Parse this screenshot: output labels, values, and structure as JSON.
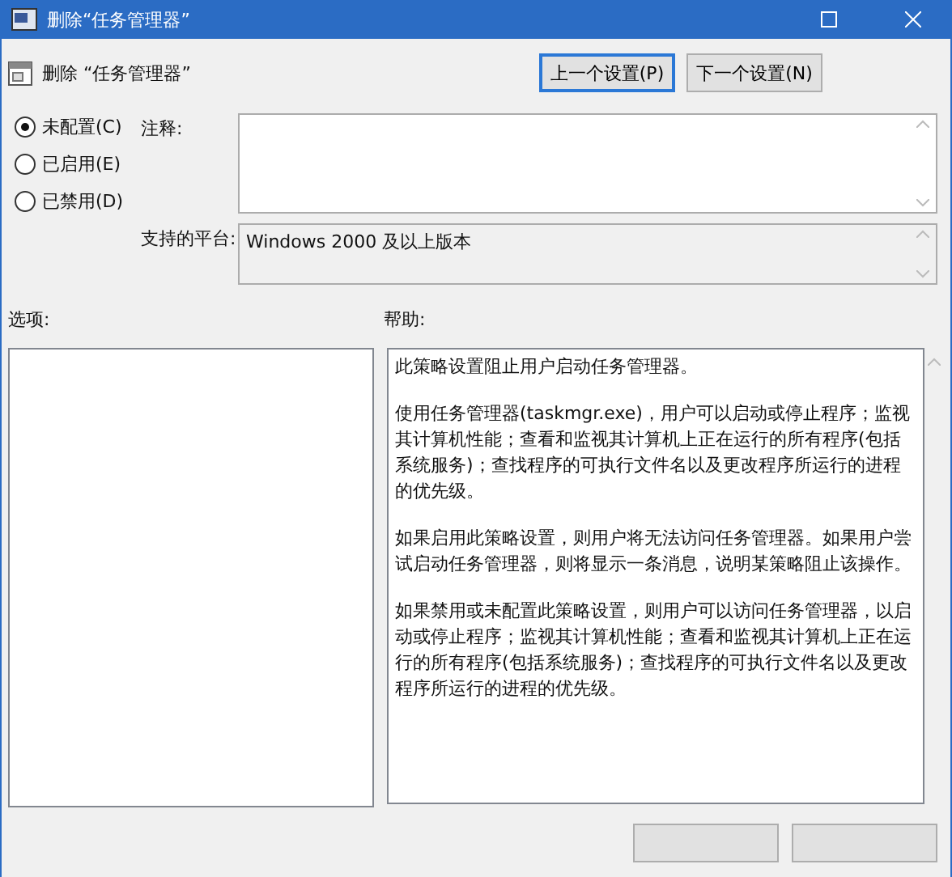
{
  "window": {
    "title": "删除“任务管理器”"
  },
  "header": {
    "title": "删除 “任务管理器”",
    "buttons": [
      {
        "label": "上一个设置(P)",
        "focused": true
      },
      {
        "label": "下一个设置(N)",
        "focused": false
      }
    ]
  },
  "states": [
    {
      "label": "未配置(C)",
      "selected": true
    },
    {
      "label": "已启用(E)",
      "selected": false
    },
    {
      "label": "已禁用(D)",
      "selected": false
    }
  ],
  "comment": {
    "label": "注释:"
  },
  "platform": {
    "label": "支持的平台:",
    "value": "Windows 2000 及以上版本"
  },
  "options": {
    "label": "选项:"
  },
  "help": {
    "label": "帮助:",
    "paragraphs": [
      "此策略设置阻止用户启动任务管理器。",
      "使用任务管理器(taskmgr.exe)，用户可以启动或停止程序；监视其计算机性能；查看和监视其计算机上正在运行的所有程序(包括系统服务)；查找程序的可执行文件名以及更改程序所运行的进程的优先级。",
      "如果启用此策略设置，则用户将无法访问任务管理器。如果用户尝试启动任务管理器，则将显示一条消息，说明某策略阻止该操作。",
      "如果禁用或未配置此策略设置，则用户可以访问任务管理器，以启动或停止程序；监视其计算机性能；查看和监视其计算机上正在运行的所有程序(包括系统服务)；查找程序的可执行文件名以及更改程序所运行的进程的优先级。"
    ]
  }
}
